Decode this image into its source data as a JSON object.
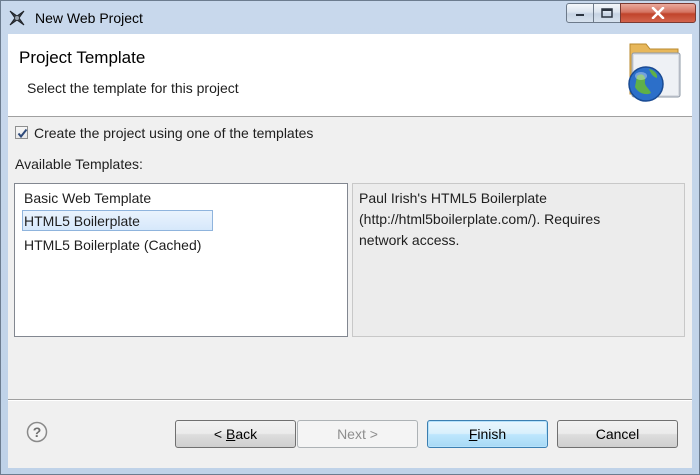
{
  "window": {
    "title": "New Web Project"
  },
  "banner": {
    "title": "Project Template",
    "subtitle": "Select the template for this project",
    "icon": "web-project-folder-globe-icon"
  },
  "options": {
    "use_template_label": "Create the project using one of the templates",
    "use_template_checked": true,
    "available_label": "Available Templates:"
  },
  "templates": {
    "items": [
      {
        "label": "Basic Web Template",
        "selected": false
      },
      {
        "label": "HTML5 Boilerplate",
        "selected": true
      },
      {
        "label": "HTML5 Boilerplate (Cached)",
        "selected": false
      }
    ],
    "description_lines": [
      "Paul Irish's HTML5 Boilerplate",
      "(http://html5boilerplate.com/). Requires",
      "network access."
    ]
  },
  "buttons": {
    "back_prefix": "< ",
    "back_mnemonic": "B",
    "back_rest": "ack",
    "next": "Next >",
    "next_enabled": false,
    "finish_mnemonic": "F",
    "finish_rest": "inish",
    "cancel": "Cancel",
    "help_glyph": "?"
  },
  "colors": {
    "selection": "#d6e8fb",
    "default_button_border": "#3c7fb1",
    "close_button": "#c0442c"
  }
}
